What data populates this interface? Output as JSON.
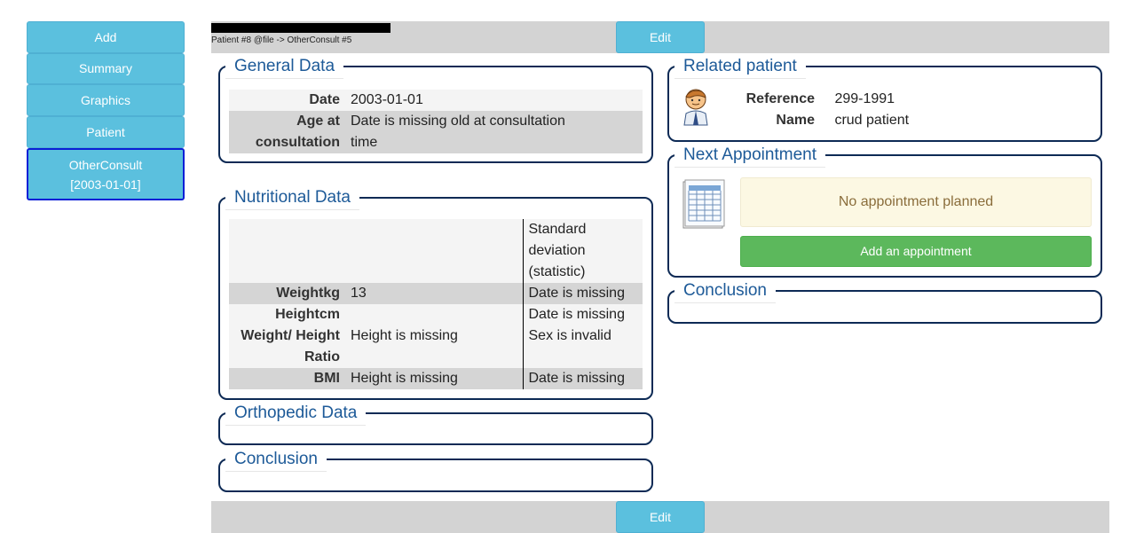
{
  "sidebar": {
    "items": [
      {
        "label": "Add"
      },
      {
        "label": "Summary"
      },
      {
        "label": "Graphics"
      },
      {
        "label": "Patient"
      },
      {
        "label": "OtherConsult",
        "sublabel": "[2003-01-01]"
      }
    ]
  },
  "header": {
    "breadcrumb": "Patient #8 @file -> OtherConsult #5",
    "edit_label": "Edit"
  },
  "footer": {
    "edit_label": "Edit"
  },
  "general_data": {
    "legend": "General Data",
    "date_label": "Date",
    "date_value": "2003-01-01",
    "age_label_1": "Age at",
    "age_label_2": "consultation",
    "age_value_1": "Date is missing old at consultation",
    "age_value_2": "time"
  },
  "nutritional_data": {
    "legend": "Nutritional Data",
    "header_1": "Standard",
    "header_2": "deviation",
    "header_3": "(statistic)",
    "rows": [
      {
        "label": "Weightkg",
        "value": "13",
        "sd": "Date is missing"
      },
      {
        "label": "Heightcm",
        "value": "",
        "sd": "Date is missing"
      },
      {
        "label_1": "Weight/ Height",
        "label_2": "Ratio",
        "value": "Height is missing",
        "sd": "Sex is invalid"
      },
      {
        "label": "BMI",
        "value": "Height is missing",
        "sd": "Date is missing"
      }
    ]
  },
  "orthopedic_data": {
    "legend": "Orthopedic Data"
  },
  "conclusion_left": {
    "legend": "Conclusion"
  },
  "related_patient": {
    "legend": "Related patient",
    "avatar_icon": "doctor-avatar-icon",
    "reference_label": "Reference",
    "reference_value": "299-1991",
    "name_label": "Name",
    "name_value": "crud patient"
  },
  "next_appointment": {
    "legend": "Next Appointment",
    "calendar_icon": "calendar-icon",
    "empty_text": "No appointment planned",
    "add_label": "Add an appointment"
  },
  "conclusion_right": {
    "legend": "Conclusion"
  },
  "colors": {
    "button_info": "#5bc0de",
    "button_success": "#5cb85c",
    "legend_text": "#1d5a98",
    "fieldset_border": "#0d2a55",
    "active_border": "#0b1fd6",
    "warning_bg": "#fcf8e3"
  }
}
